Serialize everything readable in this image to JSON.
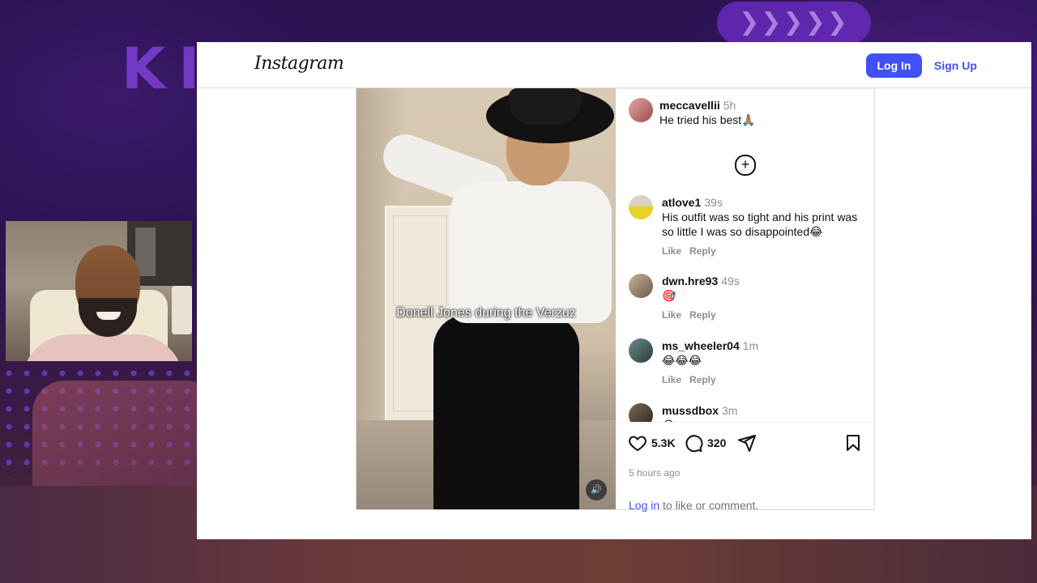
{
  "stream": {
    "brand_letters": "KI"
  },
  "header": {
    "logo": "Instagram",
    "login_label": "Log In",
    "signup_label": "Sign Up",
    "accent_color": "#4150f7"
  },
  "post": {
    "caption_overlay": "Donell Jones during the Verzuz",
    "sound_icon": "speaker-icon",
    "likes": "5.3K",
    "comments_count": "320",
    "timestamp": "5 hours ago",
    "login_prompt_link": "Log in",
    "login_prompt_text": " to like or comment."
  },
  "comments": [
    {
      "user": "meccavellii",
      "time": "5h",
      "text": "He tried his best🙏🏽",
      "show_actions": false
    },
    {
      "user": "atlove1",
      "time": "39s",
      "text": "His outfit was so tight and his print was so little I was so disappointed😂",
      "show_actions": true
    },
    {
      "user": "dwn.hre93",
      "time": "49s",
      "text": "🎯",
      "show_actions": true
    },
    {
      "user": "ms_wheeler04",
      "time": "1m",
      "text": "😂😂😂",
      "show_actions": true
    },
    {
      "user": "mussdbox",
      "time": "3m",
      "text": "😂",
      "show_actions": false
    }
  ],
  "comment_actions": {
    "like": "Like",
    "reply": "Reply"
  }
}
